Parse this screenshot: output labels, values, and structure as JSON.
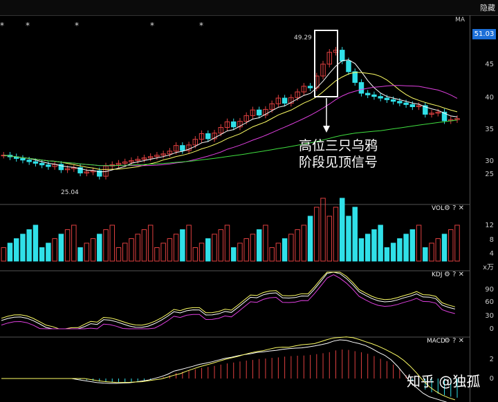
{
  "toolbar": {
    "hide_label": "隐藏"
  },
  "main_panel": {
    "indicator_label": "MA",
    "current_price": "51.03",
    "y_axis_ticks": [
      "45",
      "40",
      "35",
      "30",
      "25"
    ],
    "high_label": "49.29",
    "low_label": "25.04",
    "annotation_line1": "高位三只乌鸦",
    "annotation_line2": "阶段见顶信号"
  },
  "vol_panel": {
    "title": "VOL",
    "y_axis_ticks": [
      "12",
      "8",
      "4"
    ],
    "unit": "x万"
  },
  "kdj_panel": {
    "title": "KDJ",
    "y_axis_ticks": [
      "90",
      "60",
      "30",
      "0"
    ]
  },
  "macd_panel": {
    "title": "MACD",
    "y_axis_ticks": [
      "2",
      "0"
    ]
  },
  "watermark": "知乎 @独孤",
  "colors": {
    "up": "#e04040",
    "down": "#30e0e8",
    "ma5": "#ffffff",
    "ma10": "#ffff66",
    "ma20": "#e040e0",
    "ma60": "#40e040",
    "ma120": "#c0c070"
  },
  "icons": [
    "gear-icon",
    "help-icon",
    "close-icon"
  ]
}
